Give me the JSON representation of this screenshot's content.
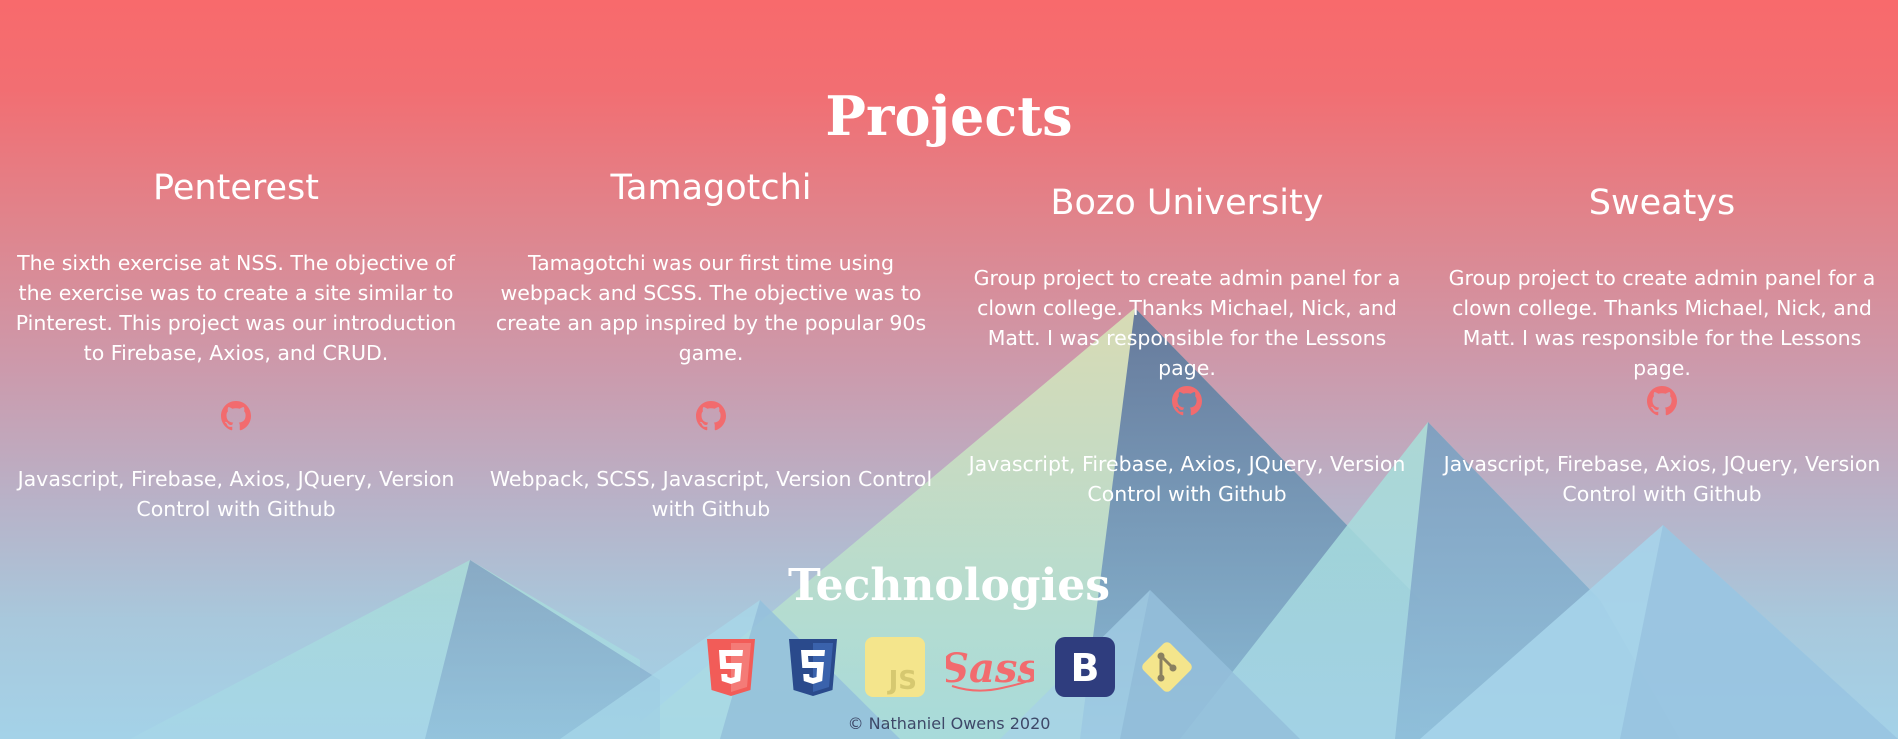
{
  "projects_section": {
    "title": "Projects",
    "items": [
      {
        "name": "Penterest",
        "description": "The sixth exercise at NSS. The objective of the exercise was to create a site similar to Pinterest. This project was our introduction to Firebase, Axios, and CRUD.",
        "link_icon": "github-icon",
        "technologies": "Javascript, Firebase, Axios, JQuery, Version Control with Github"
      },
      {
        "name": "Tamagotchi",
        "description": "Tamagotchi was our first time using webpack and SCSS. The objective was to create an app inspired by the popular 90s game.",
        "link_icon": "github-icon",
        "technologies": "Webpack, SCSS, Javascript, Version Control with Github"
      },
      {
        "name": "Bozo University",
        "description": "Group project to create admin panel for a clown college. Thanks Michael, Nick, and Matt. I was responsible for the Lessons page.",
        "link_icon": "github-icon",
        "technologies": "Javascript, Firebase, Axios, JQuery, Version Control with Github"
      },
      {
        "name": "Sweatys",
        "description": "Group project to create admin panel for a clown college. Thanks Michael, Nick, and Matt. I was responsible for the Lessons page.",
        "link_icon": "github-icon",
        "technologies": "Javascript, Firebase, Axios, JQuery, Version Control with Github"
      }
    ]
  },
  "technologies_section": {
    "title": "Technologies",
    "icons": [
      "html5-icon",
      "css3-icon",
      "javascript-icon",
      "sass-icon",
      "bootstrap-icon",
      "git-icon"
    ]
  },
  "footer": {
    "copyright": "© Nathaniel Owens 2020"
  },
  "colors": {
    "accent": "#f26b6e",
    "text": "#ffffff",
    "footer_text": "#3e4868"
  }
}
